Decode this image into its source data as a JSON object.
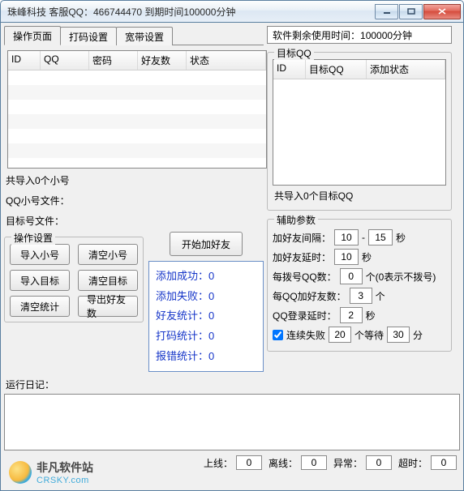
{
  "window": {
    "title": "珠峰科技 客服QQ：466744470  到期时间100000分钟"
  },
  "status_line": {
    "label": "软件剩余使用时间：",
    "value": "100000分钟"
  },
  "tabs": [
    {
      "label": "操作页面",
      "active": true
    },
    {
      "label": "打码设置",
      "active": false
    },
    {
      "label": "宽带设置",
      "active": false
    }
  ],
  "left_table": {
    "cols": [
      "ID",
      "QQ",
      "密码",
      "好友数",
      "状态"
    ]
  },
  "summary": {
    "imported_accounts": "共导入0个小号",
    "qq_small_file_label": "QQ小号文件：",
    "target_file_label": "目标号文件："
  },
  "op_settings": {
    "legend": "操作设置",
    "buttons": {
      "import_small": "导入小号",
      "clear_small": "清空小号",
      "import_target": "导入目标",
      "clear_target": "清空目标",
      "clear_stats": "清空统计",
      "export_friends": "导出好友数"
    }
  },
  "start_button": "开始加好友",
  "stats": {
    "add_success": {
      "label": "添加成功：",
      "value": "0"
    },
    "add_fail": {
      "label": "添加失败：",
      "value": "0"
    },
    "friend_stat": {
      "label": "好友统计：",
      "value": "0"
    },
    "dama_stat": {
      "label": "打码统计：",
      "value": "0"
    },
    "error_stat": {
      "label": "报错统计：",
      "value": "0"
    }
  },
  "target_qq": {
    "legend": "目标QQ",
    "cols": [
      "ID",
      "目标QQ",
      "添加状态"
    ],
    "summary": "共导入0个目标QQ"
  },
  "aux": {
    "legend": "辅助参数",
    "interval_label": "加好友间隔：",
    "interval_min": "10",
    "interval_sep": "-",
    "interval_max": "15",
    "sec_unit": "秒",
    "delay_label": "加好友延时：",
    "delay_val": "10",
    "dial_label": "每拨号QQ数：",
    "dial_val": "0",
    "dial_note": "个(0表示不拨号)",
    "per_qq_label": "每QQ加好友数：",
    "per_qq_val": "3",
    "count_unit": "个",
    "login_delay_label": "QQ登录延时：",
    "login_delay_val": "2",
    "fail_checkbox_label": "连续失败",
    "fail_count": "20",
    "fail_mid": "个等待",
    "fail_wait": "30",
    "min_unit": "分"
  },
  "runlog_label": "运行日记：",
  "footer": {
    "online": {
      "label": "上线：",
      "value": "0"
    },
    "offline": {
      "label": "离线：",
      "value": "0"
    },
    "abnormal": {
      "label": "异常：",
      "value": "0"
    },
    "timeout": {
      "label": "超时：",
      "value": "0"
    }
  },
  "watermark": {
    "line1": "非凡软件站",
    "line2": "CRSKY.com"
  }
}
